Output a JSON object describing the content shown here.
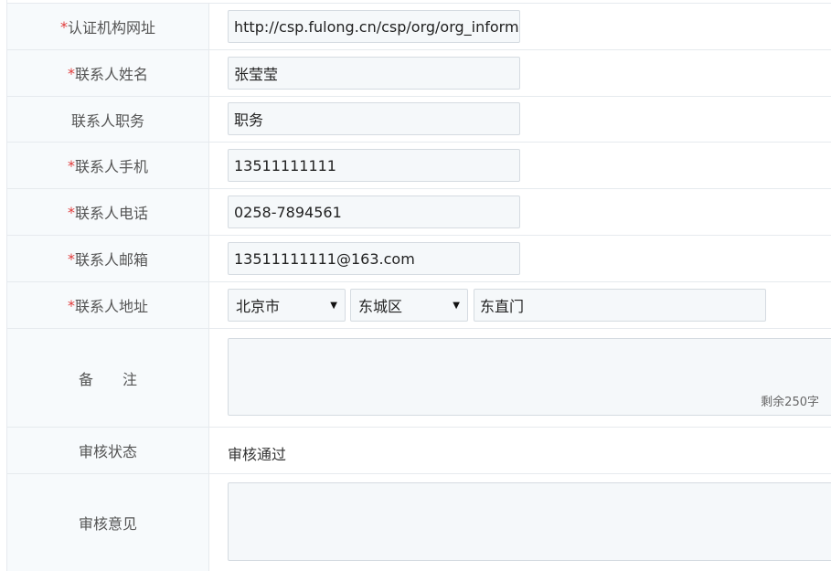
{
  "fields": {
    "website": {
      "required": "*",
      "label": "认证机构网址",
      "value": "http://csp.fulong.cn/csp/org/org_information"
    },
    "contact_name": {
      "required": "*",
      "label": "联系人姓名",
      "value": "张莹莹"
    },
    "contact_title": {
      "label": "联系人职务",
      "value": "职务"
    },
    "contact_mobile": {
      "required": "*",
      "label": "联系人手机",
      "value": "13511111111"
    },
    "contact_phone": {
      "required": "*",
      "label": "联系人电话",
      "value": "0258-7894561"
    },
    "contact_email": {
      "required": "*",
      "label": "联系人邮箱",
      "value": "13511111111@163.com"
    },
    "contact_address": {
      "required": "*",
      "label": "联系人地址",
      "city": "北京市",
      "district": "东城区",
      "street": "东直门"
    },
    "remark": {
      "label": "备　　注",
      "counter": "剩余250字"
    },
    "review_status": {
      "label": "审核状态",
      "value": "审核通过"
    },
    "review_opinion": {
      "label": "审核意见"
    }
  },
  "colors": {
    "required_marker": "#e03a3a",
    "label_background": "#f7fafc",
    "border": "#e6eaee",
    "input_background": "#f5f8fa"
  }
}
